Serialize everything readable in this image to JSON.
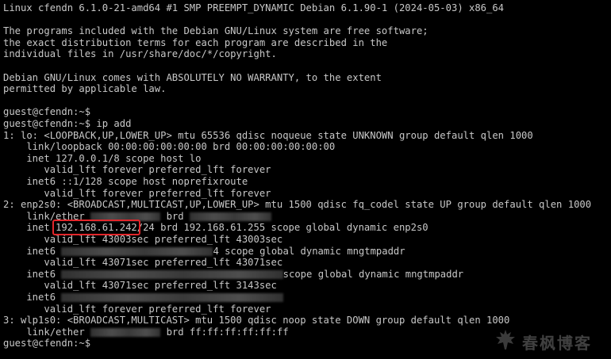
{
  "terminal": {
    "lines": [
      "Linux cfendn 6.1.0-21-amd64 #1 SMP PREEMPT_DYNAMIC Debian 6.1.90-1 (2024-05-03) x86_64",
      "",
      "The programs included with the Debian GNU/Linux system are free software;",
      "the exact distribution terms for each program are described in the",
      "individual files in /usr/share/doc/*/copyright.",
      "",
      "Debian GNU/Linux comes with ABSOLUTELY NO WARRANTY, to the extent",
      "permitted by applicable law.",
      "",
      "guest@cfendn:~$",
      "guest@cfendn:~$ ip add",
      "1: lo: <LOOPBACK,UP,LOWER_UP> mtu 65536 qdisc noqueue state UNKNOWN group default qlen 1000",
      "    link/loopback 00:00:00:00:00:00 brd 00:00:00:00:00:00",
      "    inet 127.0.0.1/8 scope host lo",
      "       valid_lft forever preferred_lft forever",
      "    inet6 ::1/128 scope host noprefixroute",
      "       valid_lft forever preferred_lft forever",
      "2: enp2s0: <BROADCAST,MULTICAST,UP,LOWER_UP> mtu 1500 qdisc fq_codel state UP group default qlen 1000",
      "    link/ether {B:12} brd {B:14}",
      "    inet 192.168.61.242/24 brd 192.168.61.255 scope global dynamic enp2s0",
      "       valid_lft 43003sec preferred_lft 43003sec",
      "    inet6 {B:26}4 scope global dynamic mngtmpaddr",
      "       valid_lft 43071sec preferred_lft 43071sec",
      "    inet6 {B:38}scope global dynamic mngtmpaddr",
      "       valid_lft 43071sec preferred_lft 3143sec",
      "    inet6 {B:38}",
      "       valid_lft forever preferred_lft forever",
      "3: wlp1s0: <BROADCAST,MULTICAST> mtu 1500 qdisc noop state DOWN group default qlen 1000",
      "    link/ether {B:12} brd ff:ff:ff:ff:ff:ff",
      "guest@cfendn:~$"
    ]
  },
  "highlight": {
    "text": "192.168.61.242",
    "color": "#e3262b"
  },
  "watermark": {
    "text": "春枫博客",
    "icon": "maple-leaf-icon"
  },
  "colors": {
    "background": "#000000",
    "foreground": "#c8c8c8"
  }
}
